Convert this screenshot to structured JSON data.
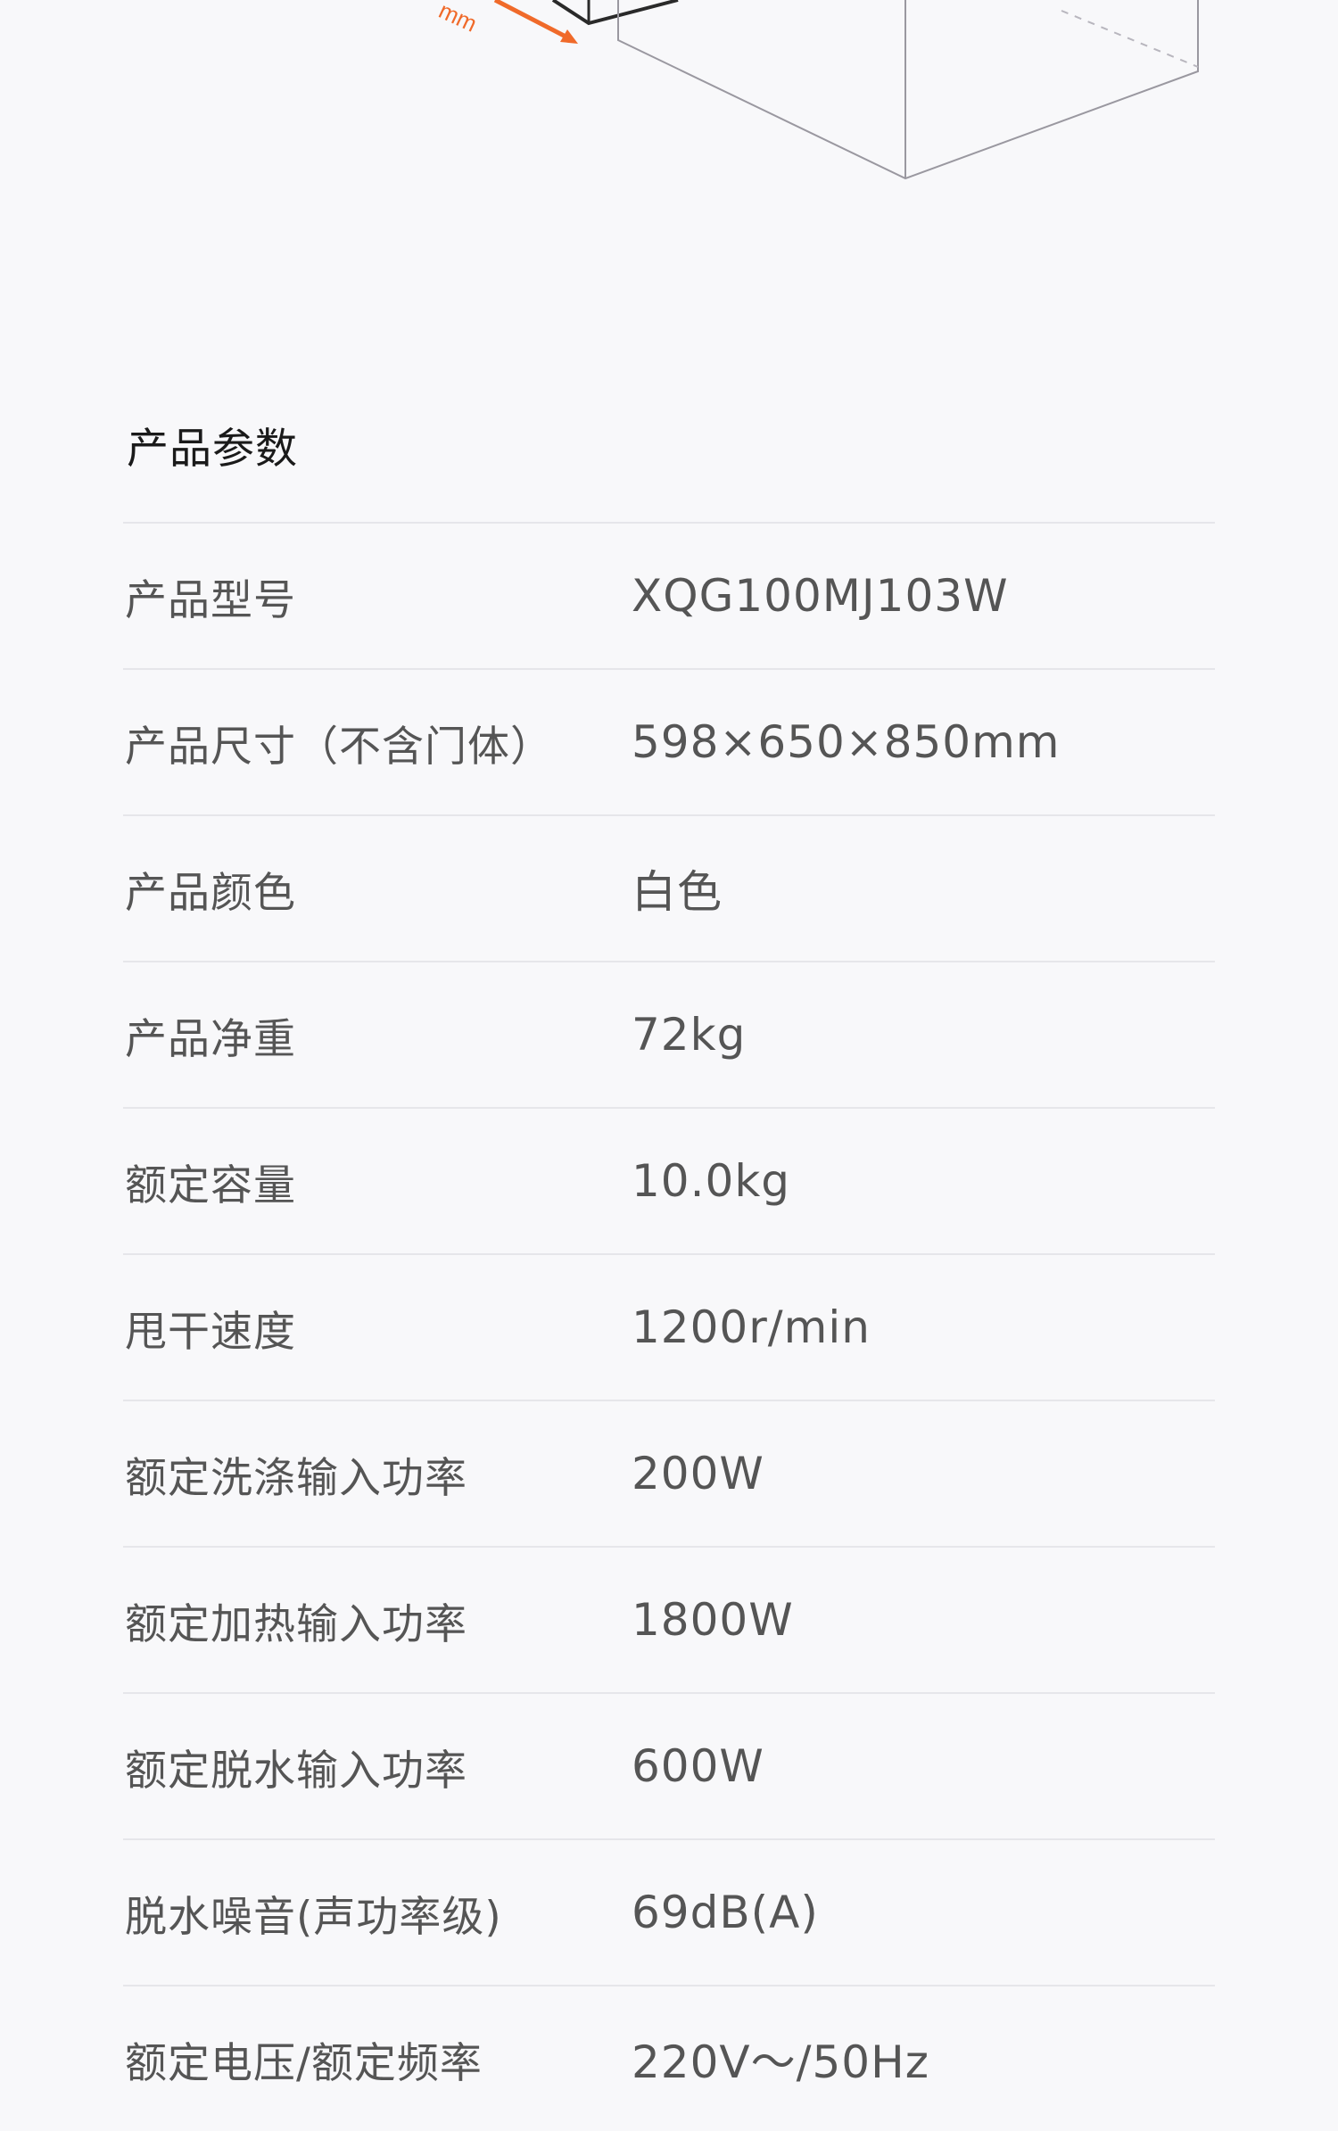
{
  "illustration": {
    "dimension_label": "mm",
    "accent_color": "#f06a2a",
    "line_color": "#8a8890"
  },
  "specs": {
    "title": "产品参数",
    "rows": [
      {
        "label": "产品型号",
        "value": "XQG100MJ103W"
      },
      {
        "label": "产品尺寸（不含门体）",
        "value": "598×650×850mm"
      },
      {
        "label": "产品颜色",
        "value": "白色"
      },
      {
        "label": "产品净重",
        "value": "72kg"
      },
      {
        "label": "额定容量",
        "value": "10.0kg"
      },
      {
        "label": "甩干速度",
        "value": "1200r/min"
      },
      {
        "label": "额定洗涤输入功率",
        "value": "200W"
      },
      {
        "label": "额定加热输入功率",
        "value": "1800W"
      },
      {
        "label": "额定脱水输入功率",
        "value": "600W"
      },
      {
        "label": "脱水噪音(声功率级)",
        "value": "69dB(A)"
      },
      {
        "label": "额定电压/额定频率",
        "value": "220V～/50Hz"
      }
    ]
  }
}
